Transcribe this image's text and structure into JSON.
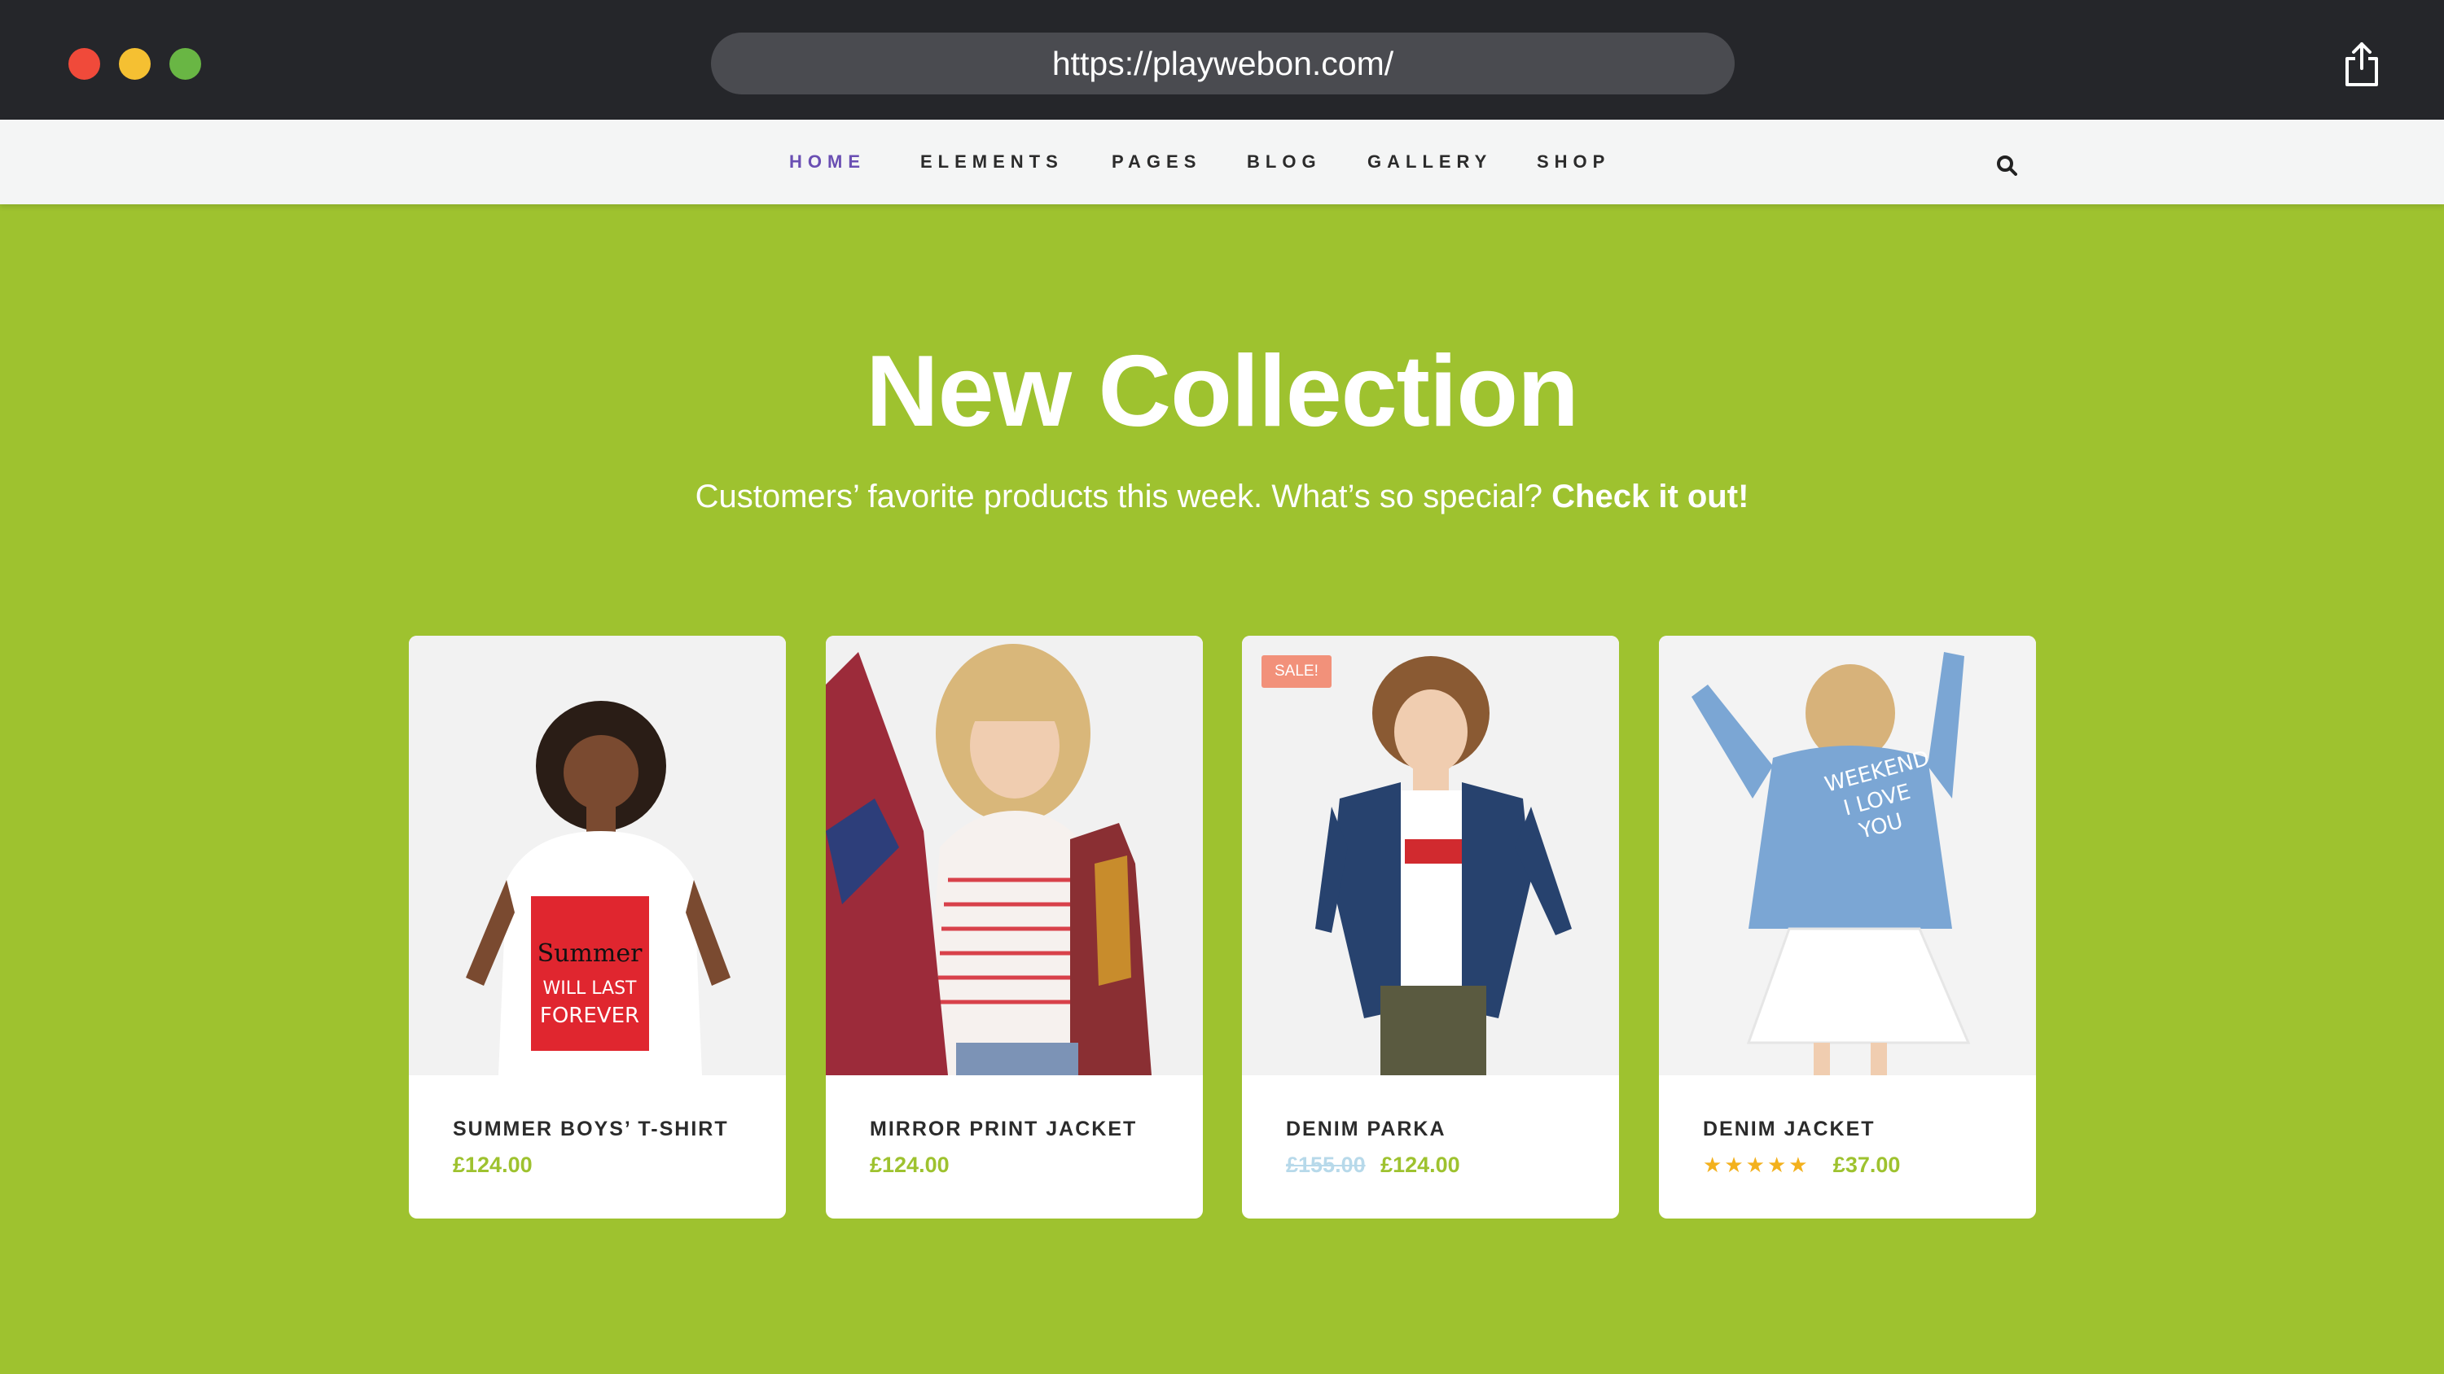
{
  "browser": {
    "url": "https://playwebon.com/",
    "icons": [
      "close-dot",
      "minimize-dot",
      "zoom-dot",
      "share-icon"
    ]
  },
  "nav": {
    "items": [
      {
        "label": "HOME",
        "active": true
      },
      {
        "label": "ELEMENTS",
        "active": false
      },
      {
        "label": "PAGES",
        "active": false
      },
      {
        "label": "BLOG",
        "active": false
      },
      {
        "label": "GALLERY",
        "active": false
      },
      {
        "label": "SHOP",
        "active": false
      }
    ],
    "search_icon": "search-icon"
  },
  "hero": {
    "title": "New Collection",
    "subtitle": "Customers’ favorite products this week. What’s so special?",
    "subtitle_link": "Check it out!"
  },
  "products": [
    {
      "name": "SUMMER BOYS’ T-SHIRT",
      "price": "£124.00"
    },
    {
      "name": "MIRROR PRINT JACKET",
      "price": "£124.00"
    },
    {
      "name": "DENIM PARKA",
      "old_price": "£155.00",
      "price": "£124.00",
      "badge": "SALE!"
    },
    {
      "name": "DENIM JACKET",
      "price": "£37.00",
      "rating": 5
    }
  ],
  "colors": {
    "background": "#9ec22f",
    "accent_price": "#9ec22f",
    "nav_active": "#6a4fb3",
    "sale_badge": "#f2917a",
    "stars": "#f3b11d"
  }
}
